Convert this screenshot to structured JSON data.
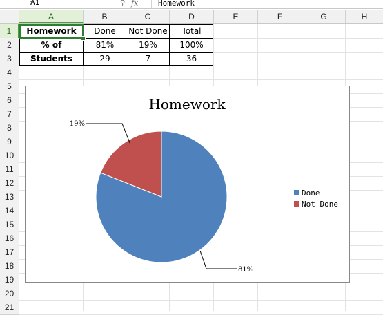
{
  "formula_bar": {
    "name_box": "A1",
    "zoom_icon": "magnifier-icon",
    "fx_label": "fx",
    "content": "Homework"
  },
  "columns": [
    "A",
    "B",
    "C",
    "D",
    "E",
    "F",
    "G",
    "H"
  ],
  "rows": [
    "1",
    "2",
    "3",
    "4",
    "5",
    "6",
    "7",
    "8",
    "9",
    "10",
    "11",
    "12",
    "13",
    "14",
    "15",
    "16",
    "17",
    "18",
    "19",
    "20",
    "21"
  ],
  "table": {
    "r1": [
      "Homework",
      "Done",
      "Not Done",
      "Total"
    ],
    "r2": [
      "% of Students",
      "81%",
      "19%",
      "100%"
    ],
    "r3": [
      "Students",
      "29",
      "7",
      "36"
    ]
  },
  "chart": {
    "title": "Homework",
    "label_done": "81%",
    "label_not_done": "19%",
    "legend": [
      "Done",
      "Not Done"
    ]
  },
  "chart_data": {
    "type": "pie",
    "title": "Homework",
    "categories": [
      "Done",
      "Not Done"
    ],
    "values": [
      81,
      19
    ],
    "data_labels": [
      "81%",
      "19%"
    ],
    "colors": [
      "#4f81bd",
      "#c0504d"
    ],
    "legend_position": "right"
  },
  "colors": {
    "selected_header_bg": "#e1f0d7",
    "selection_border": "#2e7d32"
  }
}
